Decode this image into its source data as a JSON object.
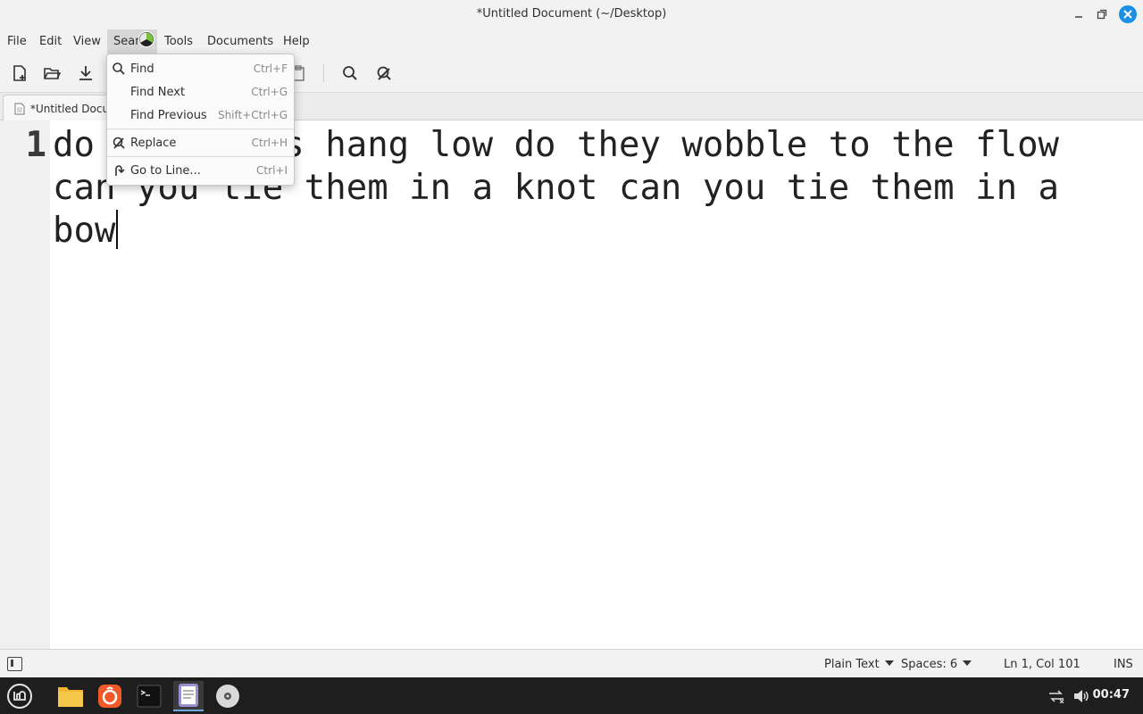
{
  "window": {
    "title": "*Untitled Document (~/Desktop)"
  },
  "menubar": {
    "items": [
      {
        "label": "File"
      },
      {
        "label": "Edit"
      },
      {
        "label": "View"
      },
      {
        "label": "Sear"
      },
      {
        "label": "Tools"
      },
      {
        "label": "Documents"
      },
      {
        "label": "Help"
      }
    ]
  },
  "toolbar": {
    "icons": [
      "new-document-icon",
      "open-folder-icon",
      "save-download-icon",
      "paste-icon",
      "search-icon",
      "replace-icon"
    ]
  },
  "tabs": [
    {
      "label": "*Untitled Docu",
      "icon": "document-icon"
    }
  ],
  "editor": {
    "line_number": "1",
    "content": "do your ears hang low do they wobble to the flow can you tie them in a knot can you tie them in a bow"
  },
  "search_menu": {
    "items": [
      {
        "label": "Find",
        "shortcut": "Ctrl+F",
        "icon": "search-icon"
      },
      {
        "label": "Find Next",
        "shortcut": "Ctrl+G",
        "icon": ""
      },
      {
        "label": "Find Previous",
        "shortcut": "Shift+Ctrl+G",
        "icon": ""
      },
      {
        "label": "Replace",
        "shortcut": "Ctrl+H",
        "icon": "replace-icon"
      },
      {
        "label": "Go to Line...",
        "shortcut": "Ctrl+I",
        "icon": "go-to-line-icon"
      }
    ]
  },
  "statusbar": {
    "language": "Plain Text",
    "spaces": "Spaces: 6",
    "position": "Ln 1, Col 101",
    "mode": "INS"
  },
  "taskbar": {
    "clock": "00:47",
    "apps": [
      "mint-menu-icon",
      "files-icon",
      "firefox-icon",
      "terminal-icon",
      "text-editor-icon",
      "disc-icon"
    ]
  },
  "colors": {
    "accent": "#1a8fe3",
    "taskbar_bg": "#1e1e1e",
    "editor_bg": "#ffffff"
  }
}
